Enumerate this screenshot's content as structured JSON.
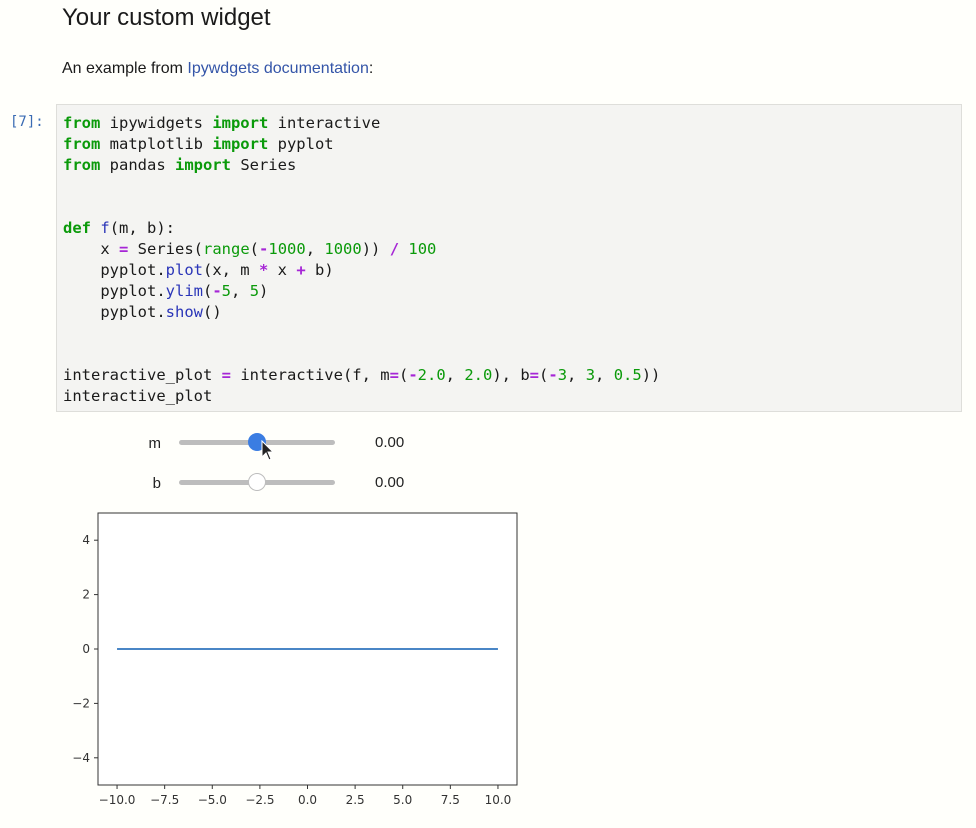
{
  "heading": "Your custom widget",
  "intro": {
    "prefix": "An example from ",
    "link_text": "Ipywdgets documentation",
    "suffix": ":"
  },
  "cell": {
    "prompt": "[7]:",
    "code_lines": [
      "from ipywidgets import interactive",
      "from matplotlib import pyplot",
      "from pandas import Series",
      "",
      "",
      "def f(m, b):",
      "    x = Series(range(-1000, 1000)) / 100",
      "    pyplot.plot(x, m * x + b)",
      "    pyplot.ylim(-5, 5)",
      "    pyplot.show()",
      "",
      "",
      "interactive_plot = interactive(f, m=(-2.0, 2.0), b=(-3, 3, 0.5))",
      "interactive_plot"
    ]
  },
  "widgets": {
    "m": {
      "label": "m",
      "value": 0.0,
      "min": -2.0,
      "max": 2.0,
      "readout": "0.00"
    },
    "b": {
      "label": "b",
      "value": 0.0,
      "min": -3.0,
      "max": 3.0,
      "readout": "0.00"
    }
  },
  "colors": {
    "line": "#4a86c6",
    "slider_active": "#3b7de2",
    "link": "#3455a8",
    "keyword": "#0a9a0a",
    "operator": "#a626d6"
  },
  "chart_data": {
    "type": "line",
    "title": "",
    "xlabel": "",
    "ylabel": "",
    "xlim": [
      -11.0,
      11.0
    ],
    "ylim": [
      -5,
      5
    ],
    "xticks": [
      -10.0,
      -7.5,
      -5.0,
      -2.5,
      0.0,
      2.5,
      5.0,
      7.5,
      10.0
    ],
    "xtick_labels": [
      "−10.0",
      "−7.5",
      "−5.0",
      "−2.5",
      "0.0",
      "2.5",
      "5.0",
      "7.5",
      "10.0"
    ],
    "yticks": [
      -4,
      -2,
      0,
      2,
      4
    ],
    "ytick_labels": [
      "−4",
      "−2",
      "0",
      "2",
      "4"
    ],
    "series": [
      {
        "x": [
          -10.0,
          10.0
        ],
        "y": [
          0.0,
          0.0
        ]
      }
    ],
    "grid": false
  }
}
